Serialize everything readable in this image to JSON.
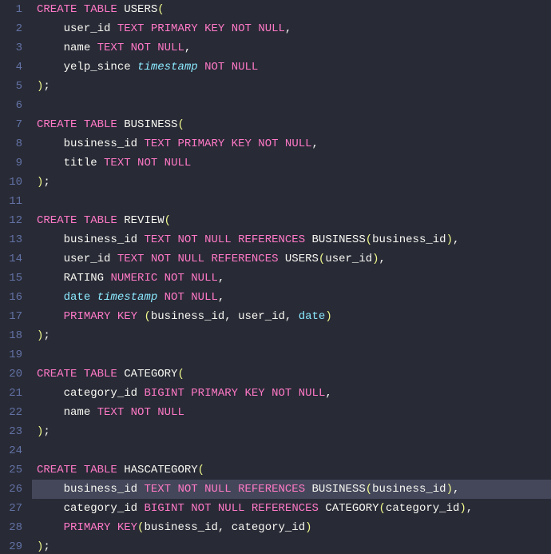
{
  "lineCount": 29,
  "highlightLine": 26,
  "tokens": {
    "create": "CREATE",
    "table": "TABLE",
    "text": "TEXT",
    "primary": "PRIMARY",
    "key": "KEY",
    "not": "NOT",
    "null": "NULL",
    "references": "REFERENCES",
    "numeric": "NUMERIC",
    "bigint": "BIGINT",
    "timestamp": "timestamp"
  },
  "tables": {
    "users": "USERS",
    "business": "BUSINESS",
    "review": "REVIEW",
    "category": "CATEGORY",
    "hascategory": "HASCATEGORY"
  },
  "cols": {
    "user_id": "user_id",
    "name": "name",
    "yelp_since": "yelp_since",
    "business_id": "business_id",
    "title": "title",
    "rating": "RATING",
    "date": "date",
    "category_id": "category_id"
  },
  "punct": {
    "open": "(",
    "close": ")",
    "comma": ",",
    "semi": ";",
    "close_semi": ");"
  },
  "space": {
    "indent": "    "
  }
}
